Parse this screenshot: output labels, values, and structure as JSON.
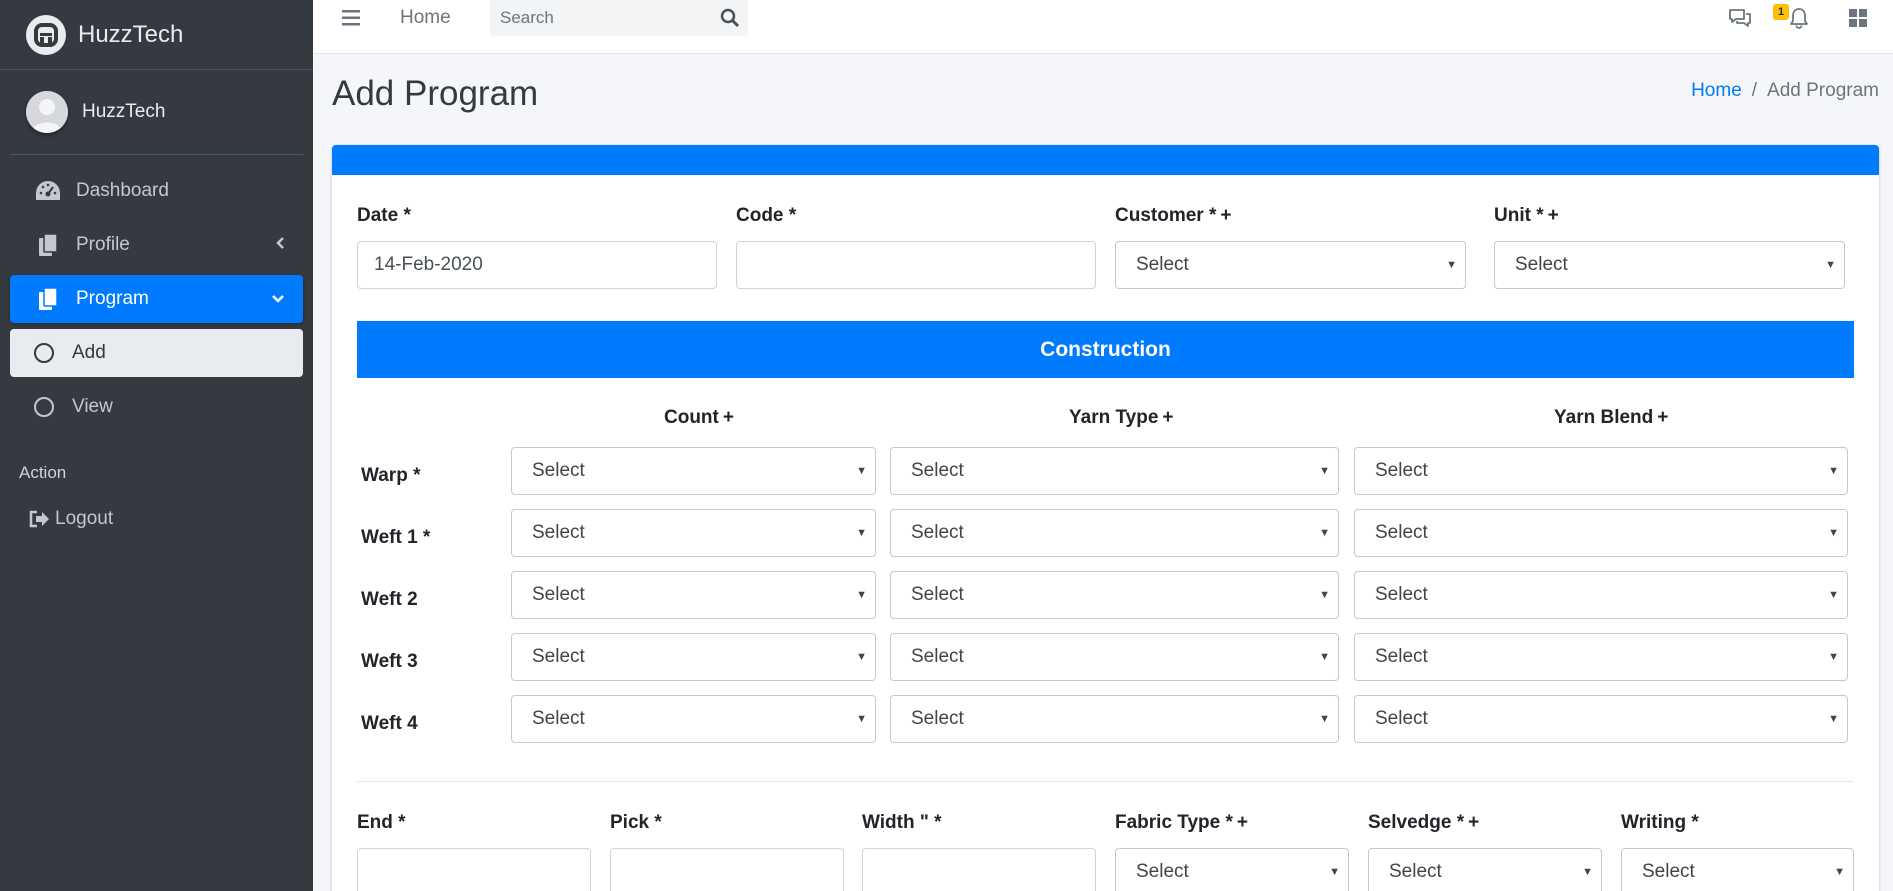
{
  "brand": {
    "name": "HuzzTech"
  },
  "user": {
    "name": "HuzzTech"
  },
  "sidebar": {
    "items": [
      {
        "label": "Dashboard",
        "icon": "tachometer-icon"
      },
      {
        "label": "Profile",
        "icon": "copy-icon"
      },
      {
        "label": "Program",
        "icon": "copy-icon"
      },
      {
        "label": "Add",
        "icon": "circle-icon"
      },
      {
        "label": "View",
        "icon": "circle-icon"
      }
    ],
    "header": "Action",
    "logout": "Logout"
  },
  "topbar": {
    "home": "Home",
    "search_placeholder": "Search",
    "notification_count": "1"
  },
  "page": {
    "title": "Add Program",
    "breadcrumb": {
      "home": "Home",
      "sep": "/",
      "current": "Add Program"
    }
  },
  "form": {
    "date_label": "Date *",
    "date_value": "14-Feb-2020",
    "code_label": "Code *",
    "code_value": "",
    "customer_label": "Customer *",
    "unit_label": "Unit *",
    "plus": "+",
    "select_placeholder": "Select",
    "construction_title": "Construction",
    "columns": {
      "count": "Count",
      "yarn_type": "Yarn Type",
      "yarn_blend": "Yarn Blend"
    },
    "rows": [
      "Warp *",
      "Weft 1 *",
      "Weft 2",
      "Weft 3",
      "Weft 4"
    ],
    "bottom": {
      "end": "End *",
      "pick": "Pick *",
      "width": "Width \" *",
      "fabric_type": "Fabric Type *",
      "selvedge": "Selvedge *",
      "writing": "Writing *"
    }
  },
  "colors": {
    "primary": "#007bff",
    "sidebar": "#343a40",
    "badge": "#ffc107"
  }
}
